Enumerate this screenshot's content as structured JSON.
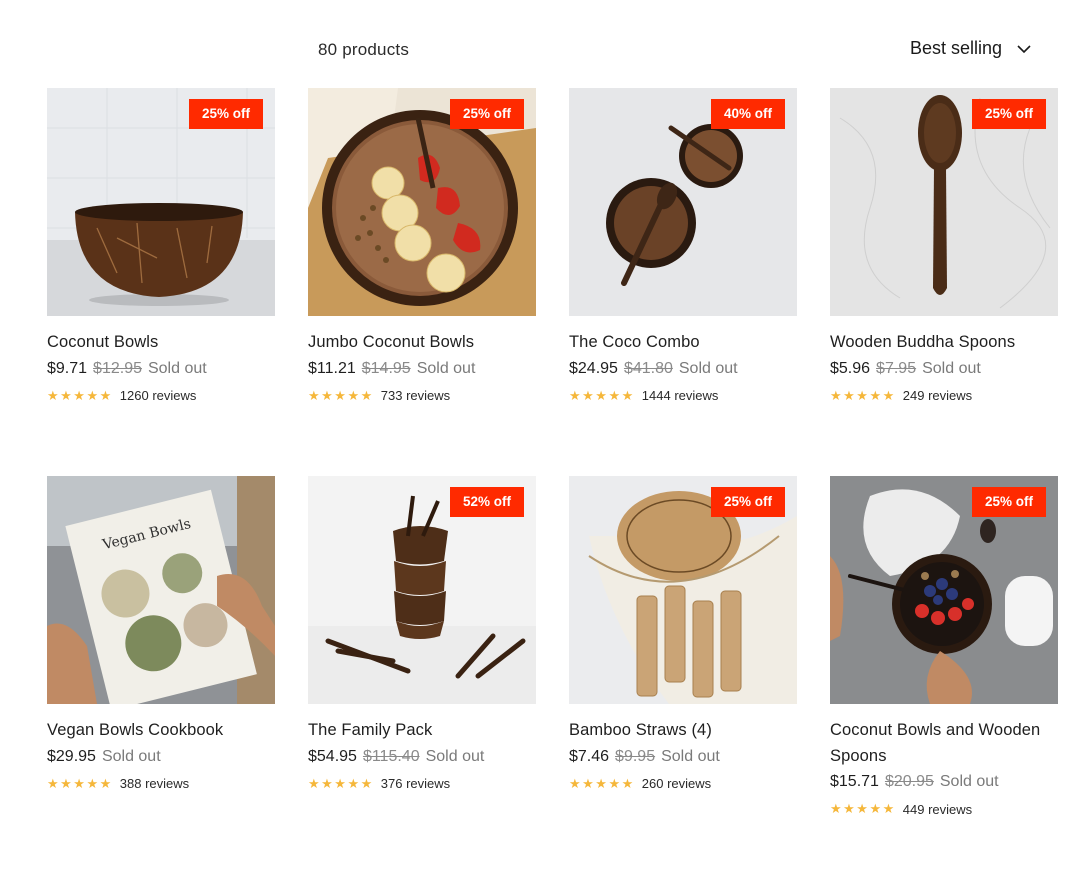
{
  "toolbar": {
    "count": "80 products",
    "sort_label": "Best selling",
    "sort_icon": "chevron-down-icon"
  },
  "colors": {
    "badge": "#ff2a00",
    "stars": "#f5b73b",
    "muted": "#8a8a8a"
  },
  "products": [
    {
      "title": "Coconut Bowls",
      "price": "$9.71",
      "compare": "$12.95",
      "status": "Sold out",
      "badge": "25% off",
      "stars": "★★★★★",
      "reviews": "1260 reviews"
    },
    {
      "title": "Jumbo Coconut Bowls",
      "price": "$11.21",
      "compare": "$14.95",
      "status": "Sold out",
      "badge": "25% off",
      "stars": "★★★★★",
      "reviews": "733 reviews"
    },
    {
      "title": "The Coco Combo",
      "price": "$24.95",
      "compare": "$41.80",
      "status": "Sold out",
      "badge": "40% off",
      "stars": "★★★★★",
      "reviews": "1444 reviews"
    },
    {
      "title": "Wooden Buddha Spoons",
      "price": "$5.96",
      "compare": "$7.95",
      "status": "Sold out",
      "badge": "25% off",
      "stars": "★★★★★",
      "reviews": "249 reviews"
    },
    {
      "title": "Vegan Bowls Cookbook",
      "price": "$29.95",
      "compare": "",
      "status": "Sold out",
      "badge": "",
      "stars": "★★★★★",
      "reviews": "388 reviews",
      "cover_title": "Vegan Bowls"
    },
    {
      "title": "The Family Pack",
      "price": "$54.95",
      "compare": "$115.40",
      "status": "Sold out",
      "badge": "52% off",
      "stars": "★★★★★",
      "reviews": "376 reviews"
    },
    {
      "title": "Bamboo Straws (4)",
      "price": "$7.46",
      "compare": "$9.95",
      "status": "Sold out",
      "badge": "25% off",
      "stars": "★★★★★",
      "reviews": "260 reviews"
    },
    {
      "title": "Coconut Bowls and Wooden Spoons",
      "price": "$15.71",
      "compare": "$20.95",
      "status": "Sold out",
      "badge": "25% off",
      "stars": "★★★★★",
      "reviews": "449 reviews"
    }
  ]
}
